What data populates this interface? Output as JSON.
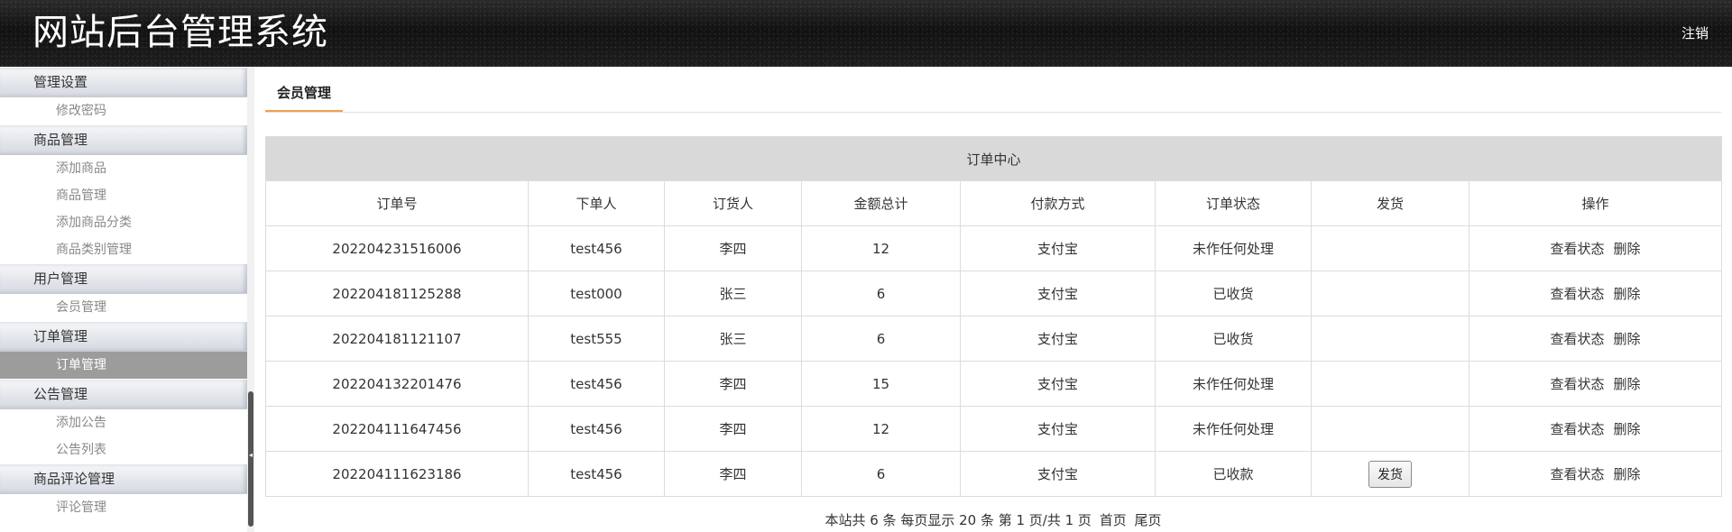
{
  "header": {
    "title": "网站后台管理系统",
    "logout_label": "注销"
  },
  "sidebar": {
    "groups": [
      {
        "title": "管理设置",
        "items": [
          "修改密码"
        ]
      },
      {
        "title": "商品管理",
        "items": [
          "添加商品",
          "商品管理",
          "添加商品分类",
          "商品类别管理"
        ]
      },
      {
        "title": "用户管理",
        "items": [
          "会员管理"
        ]
      },
      {
        "title": "订单管理",
        "items": [
          "订单管理"
        ]
      },
      {
        "title": "公告管理",
        "items": [
          "添加公告",
          "公告列表"
        ]
      },
      {
        "title": "商品评论管理",
        "items": [
          "评论管理"
        ]
      }
    ],
    "active_item": "订单管理"
  },
  "main": {
    "tab_label": "会员管理",
    "table": {
      "caption": "订单中心",
      "columns": [
        "订单号",
        "下单人",
        "订货人",
        "金额总计",
        "付款方式",
        "订单状态",
        "发货",
        "操作"
      ],
      "rows": [
        {
          "order_no": "202204231516006",
          "buyer": "test456",
          "receiver": "李四",
          "total": "12",
          "payment": "支付宝",
          "status": "未作任何处理",
          "ship": "",
          "view": "查看状态",
          "delete": "删除"
        },
        {
          "order_no": "202204181125288",
          "buyer": "test000",
          "receiver": "张三",
          "total": "6",
          "payment": "支付宝",
          "status": "已收货",
          "ship": "",
          "view": "查看状态",
          "delete": "删除"
        },
        {
          "order_no": "202204181121107",
          "buyer": "test555",
          "receiver": "张三",
          "total": "6",
          "payment": "支付宝",
          "status": "已收货",
          "ship": "",
          "view": "查看状态",
          "delete": "删除"
        },
        {
          "order_no": "202204132201476",
          "buyer": "test456",
          "receiver": "李四",
          "total": "15",
          "payment": "支付宝",
          "status": "未作任何处理",
          "ship": "",
          "view": "查看状态",
          "delete": "删除"
        },
        {
          "order_no": "202204111647456",
          "buyer": "test456",
          "receiver": "李四",
          "total": "12",
          "payment": "支付宝",
          "status": "未作任何处理",
          "ship": "",
          "view": "查看状态",
          "delete": "删除"
        },
        {
          "order_no": "202204111623186",
          "buyer": "test456",
          "receiver": "李四",
          "total": "6",
          "payment": "支付宝",
          "status": "已收款",
          "ship": "发货",
          "view": "查看状态",
          "delete": "删除"
        }
      ]
    },
    "pager": {
      "text": "本站共 6 条 每页显示 20 条 第 1 页/共 1 页",
      "first_label": "首页",
      "last_label": "尾页"
    }
  },
  "colors": {
    "tab_underline": "#f0a04b",
    "active_item_bg": "#9c9c9c",
    "caption_bg": "#d9d9d9"
  }
}
